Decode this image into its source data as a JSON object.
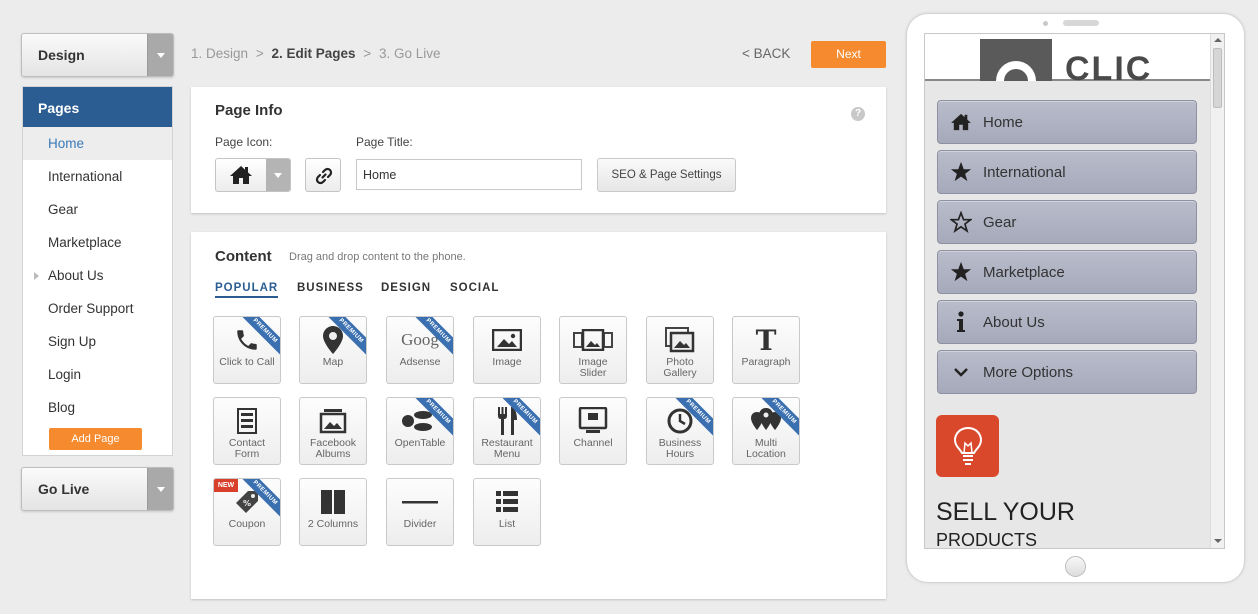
{
  "sidebar": {
    "design_label": "Design",
    "pages_header": "Pages",
    "pages": [
      {
        "label": "Home"
      },
      {
        "label": "International"
      },
      {
        "label": "Gear"
      },
      {
        "label": "Marketplace"
      },
      {
        "label": "About Us"
      },
      {
        "label": "Order Support"
      },
      {
        "label": "Sign Up"
      },
      {
        "label": "Login"
      },
      {
        "label": "Blog"
      }
    ],
    "add_page_label": "Add Page",
    "go_live_label": "Go Live"
  },
  "steps": {
    "step1": "1. Design",
    "sep1": ">",
    "step2": "2. Edit Pages",
    "sep2": ">",
    "step3": "3. Go Live",
    "back_label": "< BACK",
    "next_label": "Next"
  },
  "page_info": {
    "title": "Page Info",
    "help": "?",
    "icon_label": "Page Icon:",
    "title_label": "Page Title:",
    "title_value": "Home",
    "seo_label": "SEO & Page Settings"
  },
  "content": {
    "title": "Content",
    "subtitle": "Drag and drop content to the phone.",
    "tabs": [
      {
        "label": "POPULAR"
      },
      {
        "label": "BUSINESS"
      },
      {
        "label": "DESIGN"
      },
      {
        "label": "SOCIAL"
      }
    ],
    "ribbon_text": "PREMIUM",
    "new_text": "NEW",
    "google_text": "Goog",
    "tiles": [
      {
        "label": "Click to Call",
        "icon": "phone-icon"
      },
      {
        "label": "Map",
        "icon": "map-pin-icon"
      },
      {
        "label": "Adsense",
        "icon": "google-icon"
      },
      {
        "label": "Image",
        "icon": "image-icon"
      },
      {
        "label": "Image Slider",
        "icon": "image-slider-icon"
      },
      {
        "label": "Photo Gallery",
        "icon": "photo-gallery-icon"
      },
      {
        "label": "Paragraph",
        "icon": "text-t-icon"
      },
      {
        "label": "Contact Form",
        "icon": "form-icon"
      },
      {
        "label": "Facebook Albums",
        "icon": "facebook-albums-icon"
      },
      {
        "label": "OpenTable",
        "icon": "opentable-icon"
      },
      {
        "label": "Restaurant Menu",
        "icon": "fork-knife-icon"
      },
      {
        "label": "Channel",
        "icon": "youtube-channel-icon"
      },
      {
        "label": "Business Hours",
        "icon": "clock-icon"
      },
      {
        "label": "Multi Location",
        "icon": "multi-pin-icon"
      },
      {
        "label": "Coupon",
        "icon": "coupon-tag-icon"
      },
      {
        "label": "2 Columns",
        "icon": "columns-icon"
      },
      {
        "label": "Divider",
        "icon": "divider-icon"
      },
      {
        "label": "List",
        "icon": "list-icon"
      }
    ]
  },
  "phone": {
    "logo_text": "CLIC",
    "menu": [
      {
        "label": "Home",
        "icon": "home-icon"
      },
      {
        "label": "International",
        "icon": "star-filled-icon"
      },
      {
        "label": "Gear",
        "icon": "star-outline-icon"
      },
      {
        "label": "Marketplace",
        "icon": "star-filled-icon"
      },
      {
        "label": "About Us",
        "icon": "info-icon"
      },
      {
        "label": "More Options",
        "icon": "chevron-down-icon"
      }
    ],
    "promo_line1": "SELL YOUR",
    "promo_line2": "PRODUCTS"
  },
  "colors": {
    "accent_orange": "#f58a2e",
    "nav_blue": "#2b5d92",
    "premium_ribbon": "#3a6fb0",
    "phone_button": "#aeb1c1",
    "promo_red": "#d9482b"
  }
}
